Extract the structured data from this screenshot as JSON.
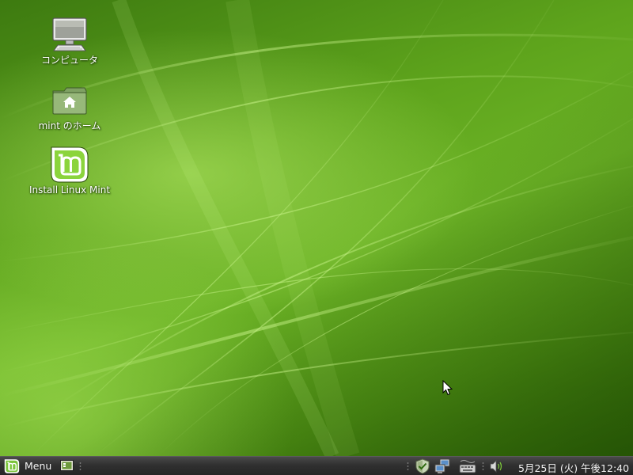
{
  "desktop": {
    "icons": [
      {
        "label": "コンピュータ",
        "icon": "computer-icon"
      },
      {
        "label": "mint のホーム",
        "icon": "home-folder-icon"
      },
      {
        "label": "Install Linux Mint",
        "icon": "linux-mint-installer-icon"
      }
    ]
  },
  "taskbar": {
    "menu_label": "Menu",
    "menu_icon": "linux-mint-logo-icon",
    "show_desktop_icon": "show-desktop-icon",
    "tray_icons": [
      "update-manager-shield-icon",
      "network-icon",
      "keyboard-layout-icon",
      "volume-icon"
    ],
    "clock": "5月25日 (火) 午後12:40"
  },
  "colors": {
    "wallpaper_green": "#5ea41c",
    "panel_dark": "#2e2e2e",
    "mint_green": "#8bd43c",
    "label_text": "#ffffff"
  }
}
